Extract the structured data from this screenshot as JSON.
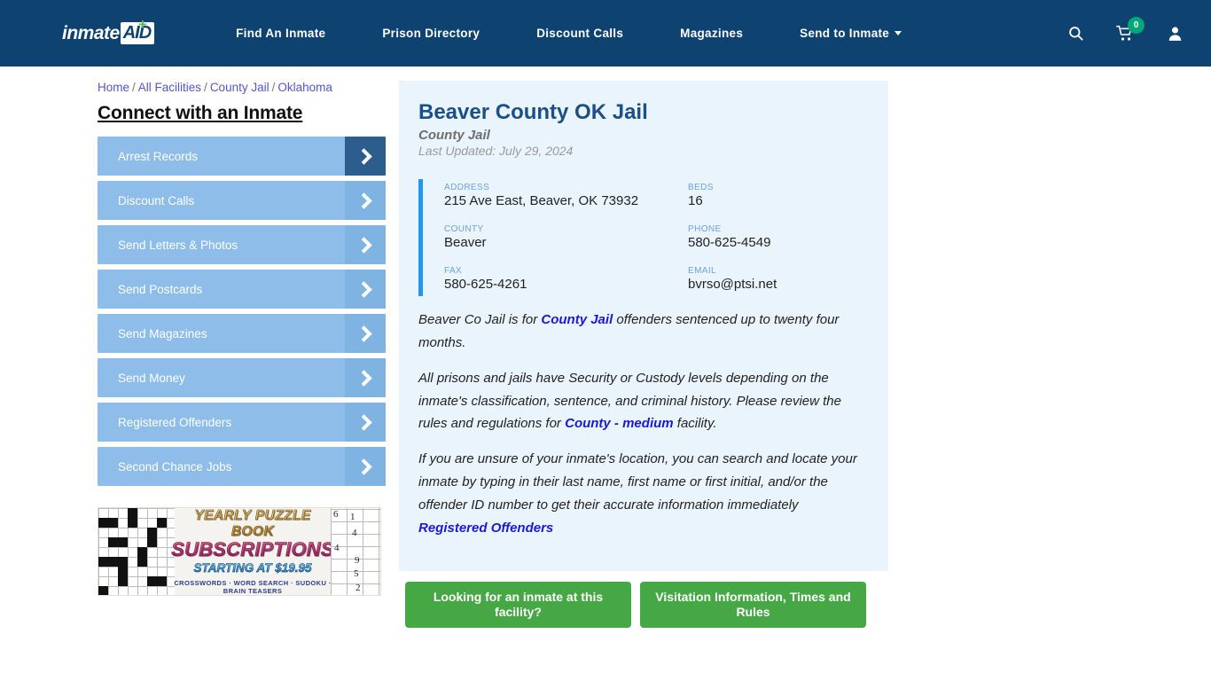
{
  "header": {
    "logo": {
      "word1": "inmate",
      "word2": "AID",
      "plus": "+"
    },
    "nav": [
      {
        "label": "Find An Inmate",
        "has_caret": false
      },
      {
        "label": "Prison Directory",
        "has_caret": false
      },
      {
        "label": "Discount Calls",
        "has_caret": false
      },
      {
        "label": "Magazines",
        "has_caret": false
      },
      {
        "label": "Send to Inmate",
        "has_caret": true
      }
    ],
    "icons": {
      "search": "search-icon",
      "cart": "shopping-cart-icon",
      "cart_count": "0",
      "account": "user-account-icon"
    },
    "colors": {
      "bar": "#0e4270",
      "badge": "#00a878"
    }
  },
  "breadcrumb": {
    "items": [
      "Home",
      "All Facilities",
      "County Jail",
      "Oklahoma"
    ],
    "separator": "/"
  },
  "sidebar": {
    "title": "Connect with an Inmate",
    "items": [
      {
        "label": "Arrest Records",
        "active": true
      },
      {
        "label": "Discount Calls",
        "active": false
      },
      {
        "label": "Send Letters & Photos",
        "active": false
      },
      {
        "label": "Send Postcards",
        "active": false
      },
      {
        "label": "Send Magazines",
        "active": false
      },
      {
        "label": "Send Money",
        "active": false
      },
      {
        "label": "Registered Offenders",
        "active": false
      },
      {
        "label": "Second Chance Jobs",
        "active": false
      }
    ]
  },
  "ad": {
    "line1": "YEARLY PUZZLE BOOK",
    "line2": "SUBSCRIPTIONS",
    "line3": "STARTING AT $19.95",
    "line4": "CROSSWORDS · WORD SEARCH · SUDOKU · BRAIN TEASERS",
    "sudoku_digits": [
      "6",
      "1",
      "4",
      "4",
      "9",
      "5",
      "2"
    ]
  },
  "facility": {
    "name": "Beaver County OK Jail",
    "type": "County Jail",
    "updated": "Last Updated: July 29, 2024",
    "info": [
      {
        "label": "ADDRESS",
        "value": "215 Ave East, Beaver, OK 73932"
      },
      {
        "label": "BEDS",
        "value": "16"
      },
      {
        "label": "COUNTY",
        "value": "Beaver"
      },
      {
        "label": "PHONE",
        "value": "580-625-4549"
      },
      {
        "label": "FAX",
        "value": "580-625-4261"
      },
      {
        "label": "EMAIL",
        "value": "bvrso@ptsi.net"
      }
    ],
    "paragraphs": {
      "p1_a": "Beaver Co Jail is for ",
      "p1_link": "County Jail",
      "p1_b": " offenders sentenced up to twenty four months.",
      "p2_a": "All prisons and jails have Security or Custody levels depending on the inmate's classification, sentence, and criminal history. Please review the rules and regulations for ",
      "p2_link": "County - medium",
      "p2_b": " facility.",
      "p3": "If you are unsure of your inmate's location, you can search and locate your inmate by typing in their last name, first name or first initial, and/or the offender ID number to get their accurate information immediately ",
      "p3_link": "Registered Offenders"
    },
    "buttons": [
      {
        "label": "Looking for an inmate at this facility?"
      },
      {
        "label": "Visitation Information, Times and Rules"
      }
    ],
    "colors": {
      "accent": "#2196f3",
      "card_bg": "#eaf4fc",
      "title": "#1b4f87",
      "button": "#45a845"
    }
  }
}
